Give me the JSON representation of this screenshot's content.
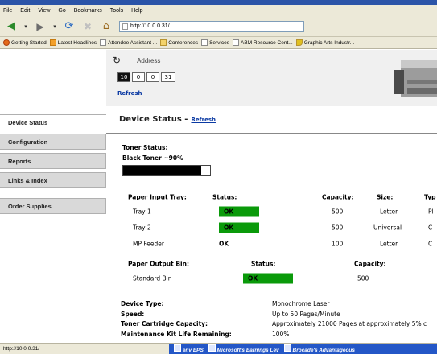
{
  "browser": {
    "menu": [
      "File",
      "Edit",
      "View",
      "Go",
      "Bookmarks",
      "Tools",
      "Help"
    ],
    "url": "http://10.0.0.31/",
    "bookmarks": [
      "Getting Started",
      "Latest Headlines",
      "Attendee Assistant ...",
      "Conferences",
      "Services",
      "ABM Resource Cent...",
      "Graphic Arts Industr..."
    ],
    "status_url": "http://10.0.0.31/",
    "taskbar": [
      "env EPS",
      "Microsoft's Earnings Lev",
      "Brocade's Advantageous"
    ]
  },
  "header": {
    "address_label": "Address",
    "octets": [
      "10",
      "0",
      "0",
      "31"
    ],
    "refresh_label": "Refresh"
  },
  "nav": {
    "items": [
      "Device Status",
      "Configuration",
      "Reports",
      "Links & Index",
      "Order Supplies"
    ]
  },
  "main": {
    "title": "Device Status -",
    "title_refresh": "Refresh",
    "toner": {
      "status_label": "Toner Status:",
      "black_label": "Black Toner ~90%",
      "level": 0.9
    },
    "input_tray": {
      "headers": [
        "Paper Input Tray:",
        "Status:",
        "Capacity:",
        "Size:",
        "Typ"
      ],
      "rows": [
        {
          "name": "Tray 1",
          "status": "OK",
          "capacity": "500",
          "size": "Letter",
          "type": "Pl"
        },
        {
          "name": "Tray 2",
          "status": "OK",
          "capacity": "500",
          "size": "Universal",
          "type": "C"
        },
        {
          "name": "MP Feeder",
          "status": "OK",
          "capacity": "100",
          "size": "Letter",
          "type": "C"
        }
      ]
    },
    "output_bin": {
      "headers": [
        "Paper Output Bin:",
        "Status:",
        "Capacity:"
      ],
      "rows": [
        {
          "name": "Standard Bin",
          "status": "OK",
          "capacity": "500"
        }
      ]
    },
    "info": [
      {
        "label": "Device Type:",
        "value": "Monochrome Laser"
      },
      {
        "label": "Speed:",
        "value": "Up to 50 Pages/Minute"
      },
      {
        "label": "Toner Cartridge Capacity:",
        "value": "Approximately 21000 Pages at approximately 5% c"
      },
      {
        "label": "Maintenance Kit Life Remaining:",
        "value": "100%"
      }
    ]
  },
  "colors": {
    "ok_green": "#0a9a0a",
    "link_blue": "#0b3aa3",
    "nav_gray": "#d9d9d9"
  }
}
